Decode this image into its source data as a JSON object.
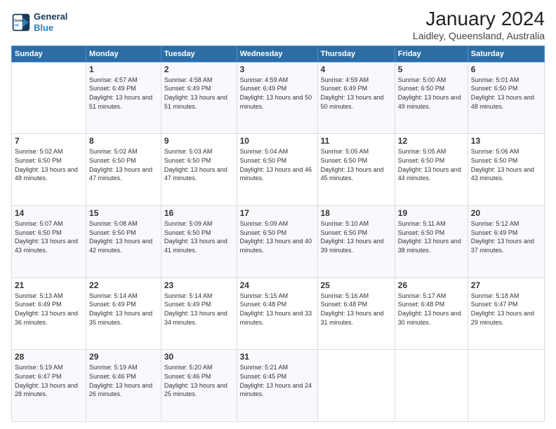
{
  "logo": {
    "line1": "General",
    "line2": "Blue"
  },
  "title": "January 2024",
  "subtitle": "Laidley, Queensland, Australia",
  "headers": [
    "Sunday",
    "Monday",
    "Tuesday",
    "Wednesday",
    "Thursday",
    "Friday",
    "Saturday"
  ],
  "weeks": [
    [
      {
        "day": "",
        "sunrise": "",
        "sunset": "",
        "daylight": ""
      },
      {
        "day": "1",
        "sunrise": "Sunrise: 4:57 AM",
        "sunset": "Sunset: 6:49 PM",
        "daylight": "Daylight: 13 hours and 51 minutes."
      },
      {
        "day": "2",
        "sunrise": "Sunrise: 4:58 AM",
        "sunset": "Sunset: 6:49 PM",
        "daylight": "Daylight: 13 hours and 51 minutes."
      },
      {
        "day": "3",
        "sunrise": "Sunrise: 4:59 AM",
        "sunset": "Sunset: 6:49 PM",
        "daylight": "Daylight: 13 hours and 50 minutes."
      },
      {
        "day": "4",
        "sunrise": "Sunrise: 4:59 AM",
        "sunset": "Sunset: 6:49 PM",
        "daylight": "Daylight: 13 hours and 50 minutes."
      },
      {
        "day": "5",
        "sunrise": "Sunrise: 5:00 AM",
        "sunset": "Sunset: 6:50 PM",
        "daylight": "Daylight: 13 hours and 49 minutes."
      },
      {
        "day": "6",
        "sunrise": "Sunrise: 5:01 AM",
        "sunset": "Sunset: 6:50 PM",
        "daylight": "Daylight: 13 hours and 48 minutes."
      }
    ],
    [
      {
        "day": "7",
        "sunrise": "Sunrise: 5:02 AM",
        "sunset": "Sunset: 6:50 PM",
        "daylight": "Daylight: 13 hours and 48 minutes."
      },
      {
        "day": "8",
        "sunrise": "Sunrise: 5:02 AM",
        "sunset": "Sunset: 6:50 PM",
        "daylight": "Daylight: 13 hours and 47 minutes."
      },
      {
        "day": "9",
        "sunrise": "Sunrise: 5:03 AM",
        "sunset": "Sunset: 6:50 PM",
        "daylight": "Daylight: 13 hours and 47 minutes."
      },
      {
        "day": "10",
        "sunrise": "Sunrise: 5:04 AM",
        "sunset": "Sunset: 6:50 PM",
        "daylight": "Daylight: 13 hours and 46 minutes."
      },
      {
        "day": "11",
        "sunrise": "Sunrise: 5:05 AM",
        "sunset": "Sunset: 6:50 PM",
        "daylight": "Daylight: 13 hours and 45 minutes."
      },
      {
        "day": "12",
        "sunrise": "Sunrise: 5:05 AM",
        "sunset": "Sunset: 6:50 PM",
        "daylight": "Daylight: 13 hours and 44 minutes."
      },
      {
        "day": "13",
        "sunrise": "Sunrise: 5:06 AM",
        "sunset": "Sunset: 6:50 PM",
        "daylight": "Daylight: 13 hours and 43 minutes."
      }
    ],
    [
      {
        "day": "14",
        "sunrise": "Sunrise: 5:07 AM",
        "sunset": "Sunset: 6:50 PM",
        "daylight": "Daylight: 13 hours and 43 minutes."
      },
      {
        "day": "15",
        "sunrise": "Sunrise: 5:08 AM",
        "sunset": "Sunset: 6:50 PM",
        "daylight": "Daylight: 13 hours and 42 minutes."
      },
      {
        "day": "16",
        "sunrise": "Sunrise: 5:09 AM",
        "sunset": "Sunset: 6:50 PM",
        "daylight": "Daylight: 13 hours and 41 minutes."
      },
      {
        "day": "17",
        "sunrise": "Sunrise: 5:09 AM",
        "sunset": "Sunset: 6:50 PM",
        "daylight": "Daylight: 13 hours and 40 minutes."
      },
      {
        "day": "18",
        "sunrise": "Sunrise: 5:10 AM",
        "sunset": "Sunset: 6:50 PM",
        "daylight": "Daylight: 13 hours and 39 minutes."
      },
      {
        "day": "19",
        "sunrise": "Sunrise: 5:11 AM",
        "sunset": "Sunset: 6:50 PM",
        "daylight": "Daylight: 13 hours and 38 minutes."
      },
      {
        "day": "20",
        "sunrise": "Sunrise: 5:12 AM",
        "sunset": "Sunset: 6:49 PM",
        "daylight": "Daylight: 13 hours and 37 minutes."
      }
    ],
    [
      {
        "day": "21",
        "sunrise": "Sunrise: 5:13 AM",
        "sunset": "Sunset: 6:49 PM",
        "daylight": "Daylight: 13 hours and 36 minutes."
      },
      {
        "day": "22",
        "sunrise": "Sunrise: 5:14 AM",
        "sunset": "Sunset: 6:49 PM",
        "daylight": "Daylight: 13 hours and 35 minutes."
      },
      {
        "day": "23",
        "sunrise": "Sunrise: 5:14 AM",
        "sunset": "Sunset: 6:49 PM",
        "daylight": "Daylight: 13 hours and 34 minutes."
      },
      {
        "day": "24",
        "sunrise": "Sunrise: 5:15 AM",
        "sunset": "Sunset: 6:48 PM",
        "daylight": "Daylight: 13 hours and 33 minutes."
      },
      {
        "day": "25",
        "sunrise": "Sunrise: 5:16 AM",
        "sunset": "Sunset: 6:48 PM",
        "daylight": "Daylight: 13 hours and 31 minutes."
      },
      {
        "day": "26",
        "sunrise": "Sunrise: 5:17 AM",
        "sunset": "Sunset: 6:48 PM",
        "daylight": "Daylight: 13 hours and 30 minutes."
      },
      {
        "day": "27",
        "sunrise": "Sunrise: 5:18 AM",
        "sunset": "Sunset: 6:47 PM",
        "daylight": "Daylight: 13 hours and 29 minutes."
      }
    ],
    [
      {
        "day": "28",
        "sunrise": "Sunrise: 5:19 AM",
        "sunset": "Sunset: 6:47 PM",
        "daylight": "Daylight: 13 hours and 28 minutes."
      },
      {
        "day": "29",
        "sunrise": "Sunrise: 5:19 AM",
        "sunset": "Sunset: 6:46 PM",
        "daylight": "Daylight: 13 hours and 26 minutes."
      },
      {
        "day": "30",
        "sunrise": "Sunrise: 5:20 AM",
        "sunset": "Sunset: 6:46 PM",
        "daylight": "Daylight: 13 hours and 25 minutes."
      },
      {
        "day": "31",
        "sunrise": "Sunrise: 5:21 AM",
        "sunset": "Sunset: 6:45 PM",
        "daylight": "Daylight: 13 hours and 24 minutes."
      },
      {
        "day": "",
        "sunrise": "",
        "sunset": "",
        "daylight": ""
      },
      {
        "day": "",
        "sunrise": "",
        "sunset": "",
        "daylight": ""
      },
      {
        "day": "",
        "sunrise": "",
        "sunset": "",
        "daylight": ""
      }
    ]
  ]
}
